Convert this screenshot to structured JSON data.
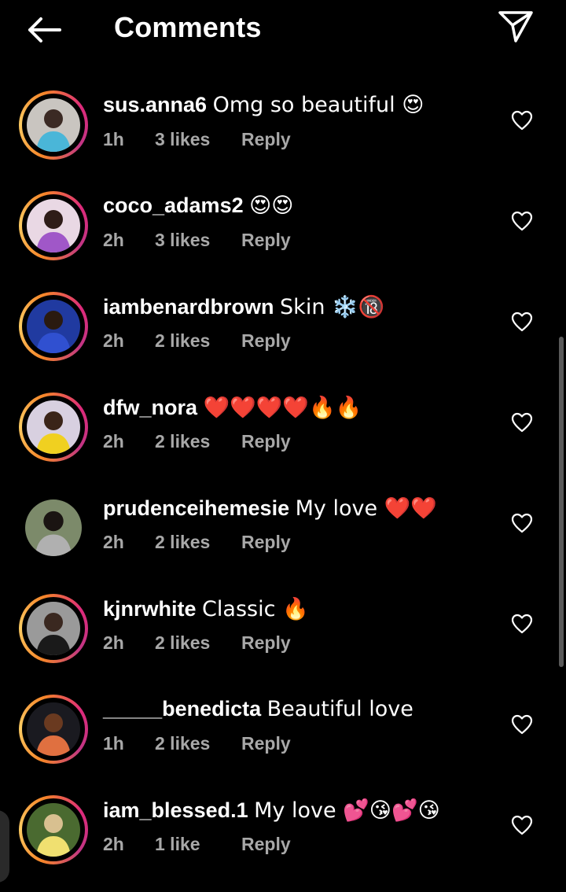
{
  "header": {
    "title": "Comments",
    "back_icon": "arrow-left-icon",
    "share_icon": "paper-plane-icon"
  },
  "reply_label": "Reply",
  "comments": [
    {
      "username": "sus.anna6",
      "text": "Omg so beautiful 😍",
      "time": "1h",
      "likes": "3 likes",
      "ring": true,
      "avatar_bg": "#c9c5c0",
      "avatar_fg": "#3b2a24",
      "accent": "#4ab6d8"
    },
    {
      "username": "coco_adams2",
      "text": "😍😍",
      "time": "2h",
      "likes": "3 likes",
      "ring": true,
      "avatar_bg": "#e9d8e4",
      "avatar_fg": "#2e1c18",
      "accent": "#a057c8"
    },
    {
      "username": "iambenardbrown",
      "text": "Skin ❄️🔞",
      "time": "2h",
      "likes": "2 likes",
      "ring": true,
      "avatar_bg": "#203aa0",
      "avatar_fg": "#2a1a10",
      "accent": "#3050d0"
    },
    {
      "username": "dfw_nora",
      "text": "❤️❤️❤️❤️🔥🔥",
      "time": "2h",
      "likes": "2 likes",
      "ring": true,
      "avatar_bg": "#d8d0e0",
      "avatar_fg": "#3a2418",
      "accent": "#f0d020"
    },
    {
      "username": "prudenceihemesie",
      "text": "My love ❤️❤️",
      "time": "2h",
      "likes": "2 likes",
      "ring": false,
      "avatar_bg": "#7c8a6a",
      "avatar_fg": "#1a1412",
      "accent": "#b0b0b0"
    },
    {
      "username": "kjnrwhite",
      "text": "Classic 🔥",
      "time": "2h",
      "likes": "2 likes",
      "ring": true,
      "avatar_bg": "#9a9a9a",
      "avatar_fg": "#3a2820",
      "accent": "#1a1a1a"
    },
    {
      "username": "_____benedicta",
      "text": "Beautiful love",
      "time": "1h",
      "likes": "2 likes",
      "ring": true,
      "avatar_bg": "#1a1a20",
      "avatar_fg": "#6a3a20",
      "accent": "#e07040"
    },
    {
      "username": "iam_blessed.1",
      "text": "My love 💕😘💕😘",
      "time": "2h",
      "likes": "1 like",
      "ring": true,
      "avatar_bg": "#4a6a30",
      "avatar_fg": "#d8c090",
      "accent": "#f0e070"
    }
  ]
}
